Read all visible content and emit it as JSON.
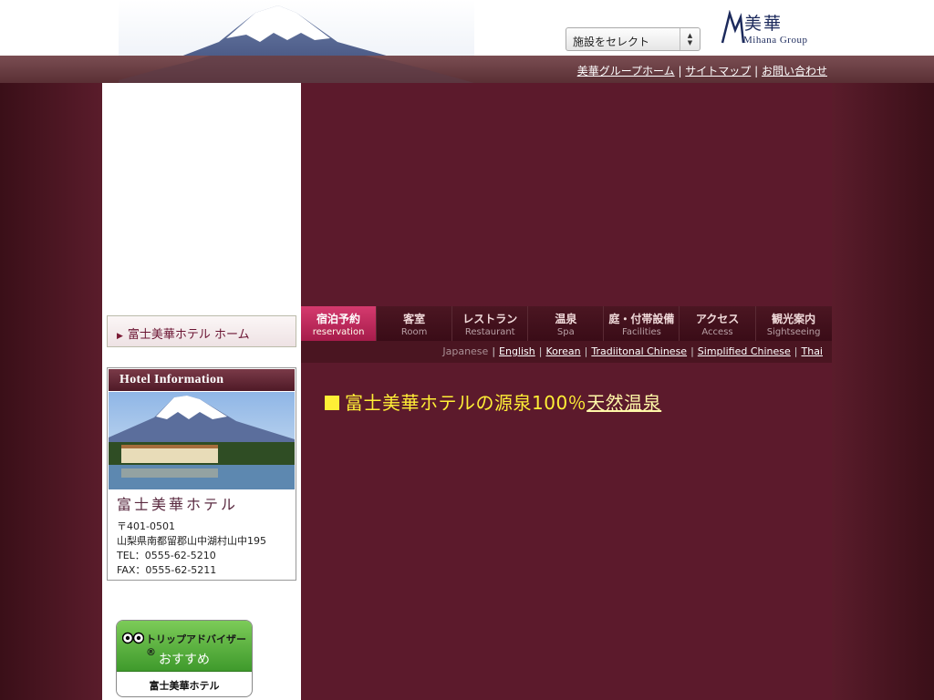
{
  "header": {
    "facility_select": "施設をセレクト",
    "logo_kanji": "美華",
    "logo_en": "Mihana Group",
    "links": [
      "美華グループホーム",
      "サイトマップ",
      "お問い合わせ"
    ]
  },
  "sidebar": {
    "home_link": "富士美華ホテル ホーム",
    "info_title": "Hotel Information",
    "hotel_name": "富士美華ホテル",
    "address_lines": [
      "〒401-0501",
      "山梨県南都留郡山中湖村山中195",
      "TEL：0555-62-5210",
      "FAX：0555-62-5211"
    ],
    "trip": {
      "brand": "トリップアドバイザー®",
      "recommend": "おすすめ",
      "name": "富士美華ホテル"
    }
  },
  "nav": [
    {
      "jp": "宿泊予約",
      "en": "reservation"
    },
    {
      "jp": "客室",
      "en": "Room"
    },
    {
      "jp": "レストラン",
      "en": "Restaurant"
    },
    {
      "jp": "温泉",
      "en": "Spa"
    },
    {
      "jp": "庭・付帯設備",
      "en": "Facilities"
    },
    {
      "jp": "アクセス",
      "en": "Access"
    },
    {
      "jp": "観光案内",
      "en": "Sightseeing"
    }
  ],
  "languages": {
    "current": "Japanese",
    "links": [
      "English",
      "Korean",
      "Tradiitonal Chinese",
      "Simplified Chinese",
      "Thai"
    ]
  },
  "headline": {
    "text": "富士美華ホテルの源泉100％",
    "link": "天然温泉"
  },
  "colors": {
    "main_bg": "#5c1a2c",
    "nav_active": "#d53a6e",
    "headline": "#ffef36"
  }
}
